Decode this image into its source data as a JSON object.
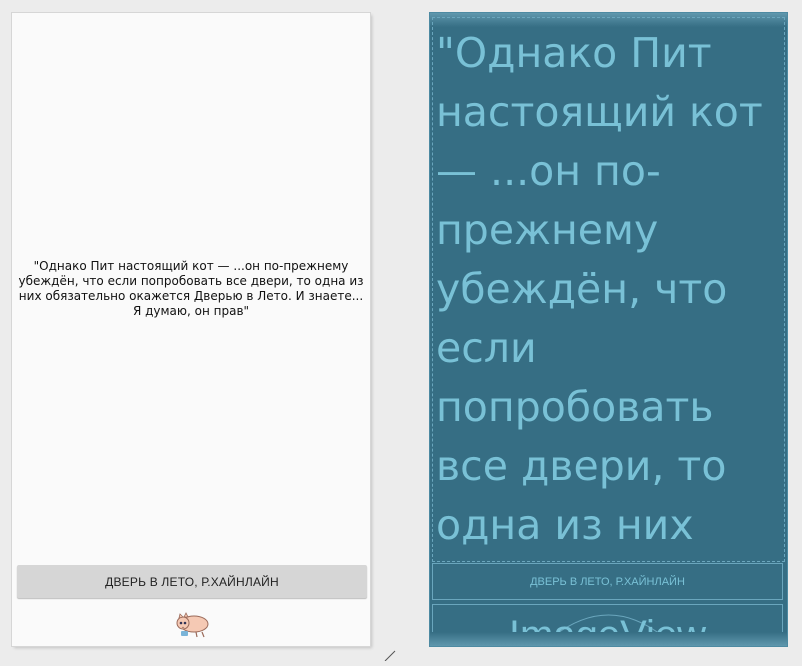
{
  "preview": {
    "quote": "\"Однако Пит настоящий кот — ...он по-прежнему убеждён, что если попробовать все двери, то одна из них обязательно окажется Дверью в Лето. И знаете... Я думаю, он прав\"",
    "button_label": "ДВЕРЬ В ЛЕТО, Р.ХАЙНЛАЙН",
    "image_icon": "cat-icon"
  },
  "blueprint": {
    "quote": "\"Однако Пит настоящий кот — ...он по-прежнему убеждён, что если попробовать все двери, то одна из них",
    "button_label": "ДВЕРЬ В ЛЕТО, Р.ХАЙНЛАЙН",
    "image_label": "ImageView"
  },
  "colors": {
    "preview_background": "#fafafa",
    "preview_button": "#d6d6d6",
    "blueprint_background": "#366e84",
    "blueprint_text": "#79c1d6",
    "blueprint_outline": "#6aa6bd"
  }
}
